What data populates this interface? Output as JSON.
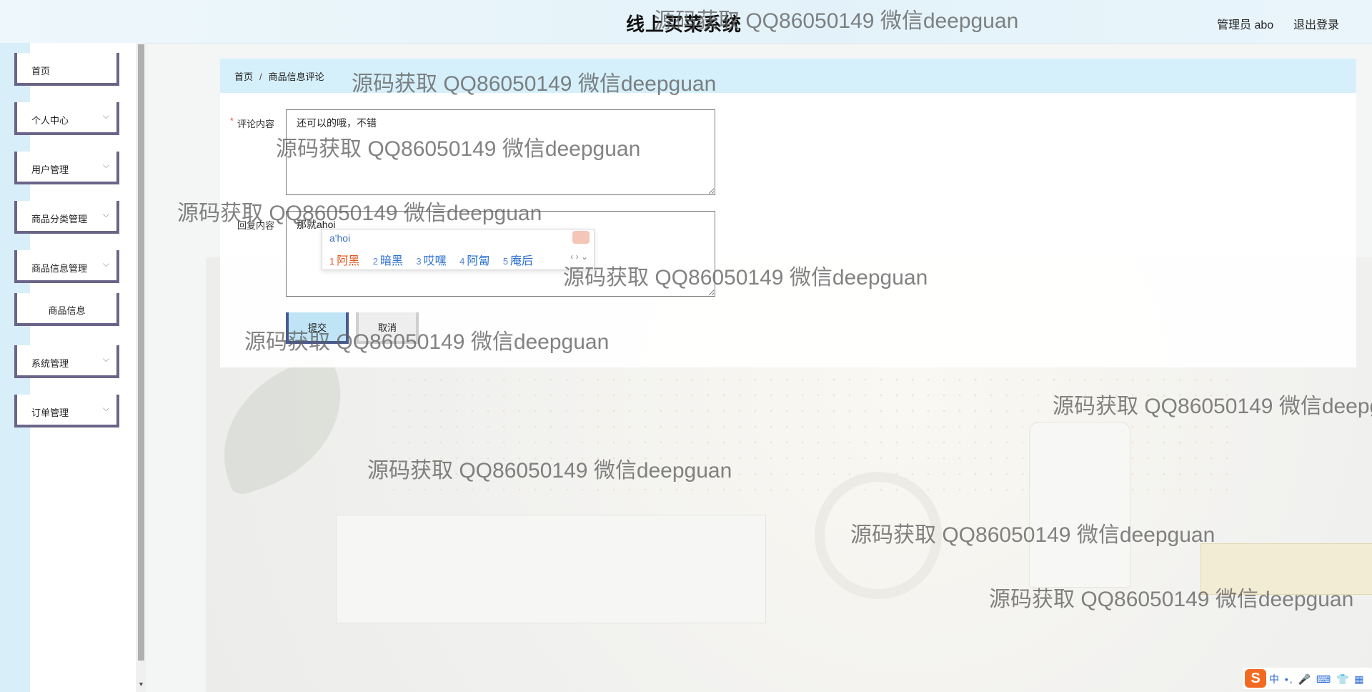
{
  "header": {
    "app_title": "线上买菜系统",
    "user_info": "管理员 abo",
    "logout_label": "退出登录"
  },
  "sidebar": {
    "items": [
      {
        "label": "首页",
        "has_submenu": false
      },
      {
        "label": "个人中心",
        "has_submenu": true
      },
      {
        "label": "用户管理",
        "has_submenu": true
      },
      {
        "label": "商品分类管理",
        "has_submenu": true
      },
      {
        "label": "商品信息管理",
        "has_submenu": true
      },
      {
        "label": "系统管理",
        "has_submenu": true
      },
      {
        "label": "订单管理",
        "has_submenu": true
      }
    ],
    "submenu_goods_info": "商品信息",
    "chevron_icon": "chevron-down-icon"
  },
  "breadcrumb": {
    "home": "首页",
    "separator": "/",
    "current": "商品信息评论"
  },
  "form": {
    "comment_label": "评论内容",
    "comment_value": "还可以的哦，不错",
    "reply_label": "回复内容",
    "reply_value": "那就ahoi",
    "required_mark": "*",
    "submit_label": "提交",
    "cancel_label": "取消"
  },
  "ime": {
    "composition": "a'hoi",
    "candidates": [
      {
        "num": "1",
        "text": "阿黑"
      },
      {
        "num": "2",
        "text": "暗黑"
      },
      {
        "num": "3",
        "text": "哎嘿"
      },
      {
        "num": "4",
        "text": "阿匐"
      },
      {
        "num": "5",
        "text": "庵后"
      }
    ],
    "nav": "‹ › ⌄"
  },
  "watermark": "源码获取 QQ86050149 微信deepguan",
  "tray": {
    "logo": "S",
    "icons": "中 •, 🎤 ⌨ 👕 ▦"
  },
  "colors": {
    "menu_border": "#6b6489",
    "breadcrumb_bg": "#d6f0fb",
    "header_bg": "#e3f2fa",
    "ime_selected": "#e0561f",
    "ime_candidate": "#2a6fcf"
  }
}
